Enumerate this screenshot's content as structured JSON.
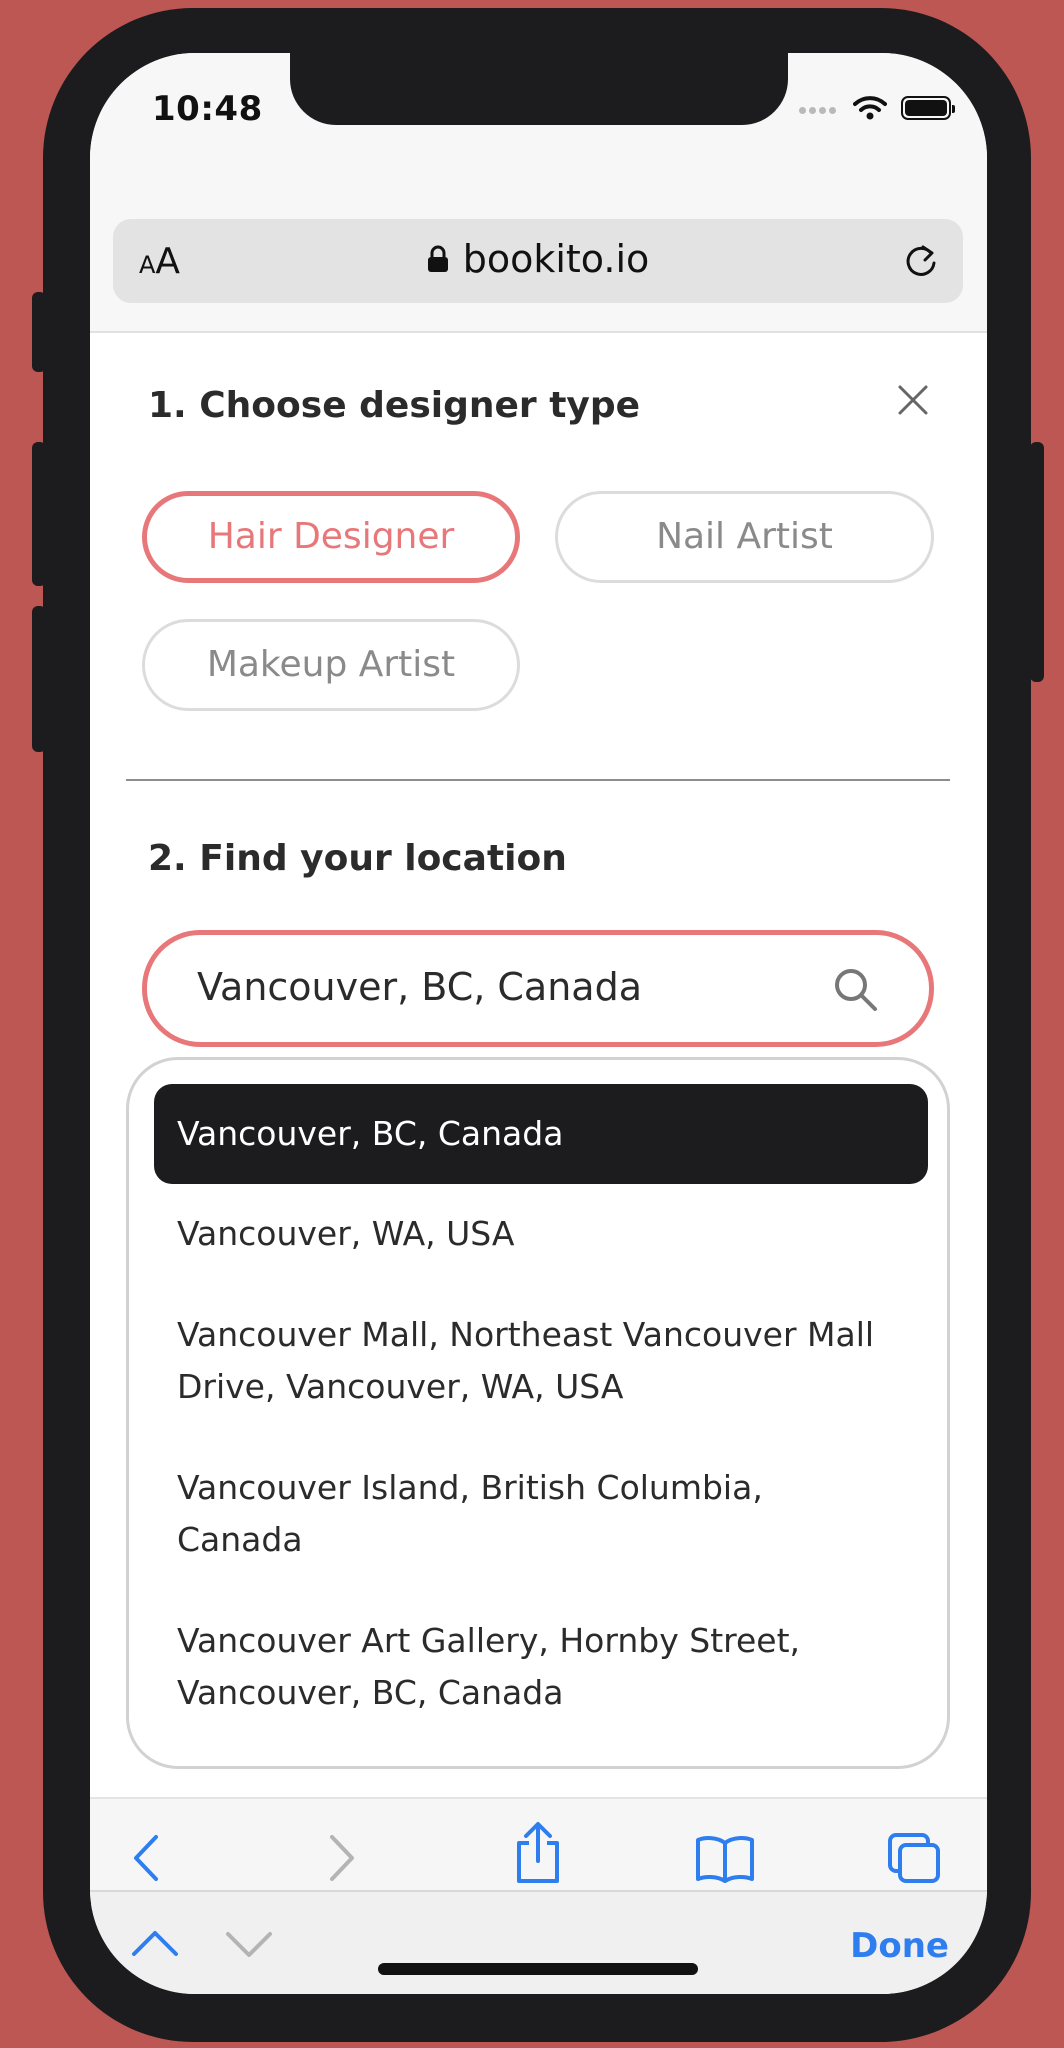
{
  "status_bar": {
    "time": "10:48"
  },
  "browser": {
    "text_size_small": "A",
    "text_size_large": "A",
    "url": "bookito.io"
  },
  "section1": {
    "title": "1. Choose designer type",
    "options": [
      {
        "label": "Hair Designer",
        "selected": true
      },
      {
        "label": "Nail Artist",
        "selected": false
      },
      {
        "label": "Makeup Artist",
        "selected": false
      }
    ]
  },
  "section2": {
    "title": "2. Find your location",
    "search_value": "Vancouver, BC, Canada",
    "suggestions": [
      {
        "line1": "Vancouver, BC, Canada",
        "line2": ""
      },
      {
        "line1": "Vancouver, WA, USA",
        "line2": ""
      },
      {
        "line1": "Vancouver Mall, Northeast Vancouver Mall",
        "line2": "Drive, Vancouver, WA, USA"
      },
      {
        "line1": "Vancouver Island, British Columbia,",
        "line2": "Canada"
      },
      {
        "line1": "Vancouver Art Gallery, Hornby Street,",
        "line2": "Vancouver, BC, Canada"
      }
    ]
  },
  "keyboard_bar": {
    "done_label": "Done"
  },
  "colors": {
    "accent": "#e8777a",
    "background": "#bd5753",
    "ios_blue": "#2f7ef0",
    "selected_bg": "#1c1c1e"
  },
  "icons": [
    "lock-icon",
    "reload-icon",
    "close-icon",
    "search-icon",
    "back-icon",
    "forward-icon",
    "share-icon",
    "bookmarks-icon",
    "tabs-icon",
    "chevron-up-icon",
    "chevron-down-icon",
    "wifi-icon",
    "battery-icon"
  ]
}
